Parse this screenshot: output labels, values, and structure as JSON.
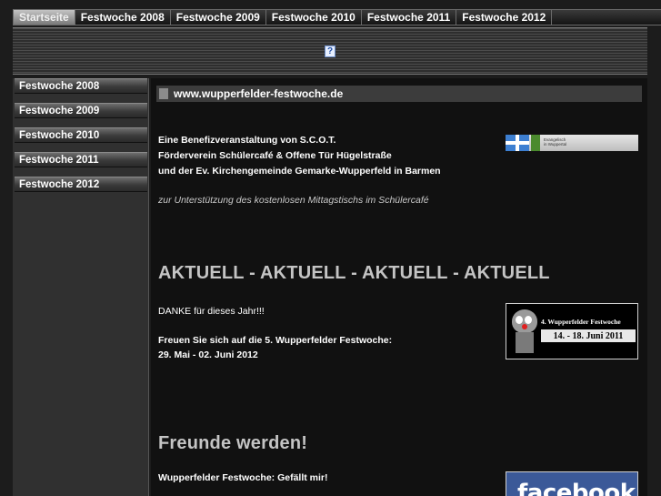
{
  "topnav": {
    "tabs": [
      {
        "label": "Startseite",
        "active": true
      },
      {
        "label": "Festwoche 2008",
        "active": false
      },
      {
        "label": "Festwoche 2009",
        "active": false
      },
      {
        "label": "Festwoche 2010",
        "active": false
      },
      {
        "label": "Festwoche 2011",
        "active": false
      },
      {
        "label": "Festwoche 2012",
        "active": false
      }
    ]
  },
  "banner": {
    "icon": "?"
  },
  "sidebar": {
    "items": [
      {
        "label": "Festwoche 2008"
      },
      {
        "label": "Festwoche 2009"
      },
      {
        "label": "Festwoche 2010"
      },
      {
        "label": "Festwoche 2011"
      },
      {
        "label": "Festwoche 2012"
      }
    ]
  },
  "main": {
    "url": "www.wupperfelder-festwoche.de",
    "intro": {
      "line1": "Eine Benefizveranstaltung von S.C.O.T.",
      "line2": "Förderverein Schülercafé & Offene Tür Hügelstraße",
      "line3": "und der Ev. Kirchengemeinde Gemarke-Wupperfeld in Barmen",
      "purpose": "zur Unterstützung des kostenlosen Mittagstischs im Schülercafé"
    },
    "sponsor_logo": {
      "text1": "Evangelisch",
      "text2": "in Wuppertal"
    },
    "aktuell": {
      "headline": "AKTUELL - AKTUELL - AKTUELL - AKTUELL",
      "thanks": "DANKE für dieses Jahr!!!",
      "next_line1": "Freuen Sie sich auf die 5. Wupperfelder Festwoche:",
      "next_line2": "29. Mai - 02. Juni 2012"
    },
    "fest_badge": {
      "title": "4. Wupperfelder Festwoche",
      "dates": "14. - 18. Juni 2011"
    },
    "friends": {
      "headline": "Freunde werden!",
      "like_name": "Wupperfelder Festwoche",
      "like_suffix": ": Gefällt mir!"
    },
    "facebook": {
      "label": "facebook"
    }
  }
}
